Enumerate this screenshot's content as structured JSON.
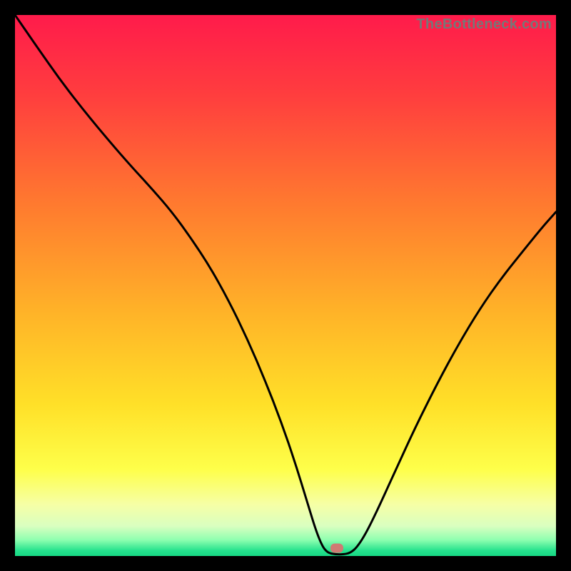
{
  "watermark": "TheBottleneck.com",
  "marker": {
    "x_frac": 0.595,
    "y_frac": 0.985
  },
  "gradient_stops": [
    {
      "offset": 0.0,
      "color": "#ff1b4b"
    },
    {
      "offset": 0.15,
      "color": "#ff3e3e"
    },
    {
      "offset": 0.35,
      "color": "#ff7a2f"
    },
    {
      "offset": 0.55,
      "color": "#ffb328"
    },
    {
      "offset": 0.72,
      "color": "#ffe028"
    },
    {
      "offset": 0.84,
      "color": "#feff4a"
    },
    {
      "offset": 0.905,
      "color": "#f6ffa6"
    },
    {
      "offset": 0.945,
      "color": "#d9ffc0"
    },
    {
      "offset": 0.97,
      "color": "#8fffb0"
    },
    {
      "offset": 0.99,
      "color": "#25e28d"
    },
    {
      "offset": 1.0,
      "color": "#17d884"
    }
  ],
  "chart_data": {
    "type": "line",
    "title": "",
    "xlabel": "",
    "ylabel": "",
    "xlim": [
      0,
      1
    ],
    "ylim": [
      0,
      1
    ],
    "series": [
      {
        "name": "bottleneck-curve",
        "points": [
          {
            "x": 0.0,
            "y": 1.0
          },
          {
            "x": 0.04,
            "y": 0.942
          },
          {
            "x": 0.085,
            "y": 0.878
          },
          {
            "x": 0.13,
            "y": 0.82
          },
          {
            "x": 0.175,
            "y": 0.766
          },
          {
            "x": 0.215,
            "y": 0.72
          },
          {
            "x": 0.252,
            "y": 0.68
          },
          {
            "x": 0.29,
            "y": 0.636
          },
          {
            "x": 0.325,
            "y": 0.588
          },
          {
            "x": 0.36,
            "y": 0.535
          },
          {
            "x": 0.395,
            "y": 0.472
          },
          {
            "x": 0.43,
            "y": 0.4
          },
          {
            "x": 0.462,
            "y": 0.325
          },
          {
            "x": 0.492,
            "y": 0.248
          },
          {
            "x": 0.518,
            "y": 0.172
          },
          {
            "x": 0.54,
            "y": 0.1
          },
          {
            "x": 0.556,
            "y": 0.048
          },
          {
            "x": 0.568,
            "y": 0.018
          },
          {
            "x": 0.578,
            "y": 0.006
          },
          {
            "x": 0.592,
            "y": 0.003
          },
          {
            "x": 0.608,
            "y": 0.003
          },
          {
            "x": 0.62,
            "y": 0.006
          },
          {
            "x": 0.632,
            "y": 0.016
          },
          {
            "x": 0.65,
            "y": 0.044
          },
          {
            "x": 0.675,
            "y": 0.096
          },
          {
            "x": 0.705,
            "y": 0.162
          },
          {
            "x": 0.74,
            "y": 0.238
          },
          {
            "x": 0.78,
            "y": 0.318
          },
          {
            "x": 0.82,
            "y": 0.392
          },
          {
            "x": 0.86,
            "y": 0.458
          },
          {
            "x": 0.9,
            "y": 0.515
          },
          {
            "x": 0.94,
            "y": 0.565
          },
          {
            "x": 0.975,
            "y": 0.608
          },
          {
            "x": 1.0,
            "y": 0.636
          }
        ]
      }
    ]
  }
}
